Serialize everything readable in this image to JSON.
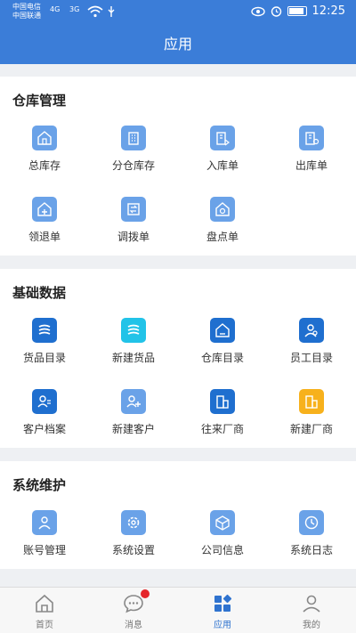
{
  "status": {
    "carrier1": "中国电信",
    "carrier2": "中国联通",
    "sig1": "4G",
    "sig2": "3G",
    "time": "12:25"
  },
  "header": {
    "title": "应用"
  },
  "sections": [
    {
      "title": "仓库管理",
      "items": [
        {
          "label": "总库存",
          "icon": "warehouse-icon"
        },
        {
          "label": "分仓库存",
          "icon": "building-icon"
        },
        {
          "label": "入库单",
          "icon": "inbound-icon"
        },
        {
          "label": "出库单",
          "icon": "outbound-icon"
        },
        {
          "label": "领退单",
          "icon": "return-icon"
        },
        {
          "label": "调拨单",
          "icon": "transfer-icon"
        },
        {
          "label": "盘点单",
          "icon": "inventory-check-icon"
        }
      ]
    },
    {
      "title": "基础数据",
      "items": [
        {
          "label": "货品目录",
          "icon": "goods-list-icon"
        },
        {
          "label": "新建货品",
          "icon": "new-goods-icon"
        },
        {
          "label": "仓库目录",
          "icon": "warehouse-list-icon"
        },
        {
          "label": "员工目录",
          "icon": "staff-icon"
        },
        {
          "label": "客户档案",
          "icon": "customer-file-icon"
        },
        {
          "label": "新建客户",
          "icon": "add-customer-icon"
        },
        {
          "label": "往来厂商",
          "icon": "vendor-icon"
        },
        {
          "label": "新建厂商",
          "icon": "new-vendor-icon"
        }
      ]
    },
    {
      "title": "系统维护",
      "items": [
        {
          "label": "账号管理",
          "icon": "account-icon"
        },
        {
          "label": "系统设置",
          "icon": "settings-icon"
        },
        {
          "label": "公司信息",
          "icon": "company-icon"
        },
        {
          "label": "系统日志",
          "icon": "log-clock-icon"
        }
      ]
    }
  ],
  "tabs": [
    {
      "label": "首页",
      "icon": "home-icon"
    },
    {
      "label": "消息",
      "icon": "message-icon"
    },
    {
      "label": "应用",
      "icon": "apps-icon"
    },
    {
      "label": "我的",
      "icon": "profile-icon"
    }
  ],
  "colors": {
    "primary": "#3b7dd8",
    "active_tab": "#2f73cf",
    "badge": "#e5252a"
  }
}
